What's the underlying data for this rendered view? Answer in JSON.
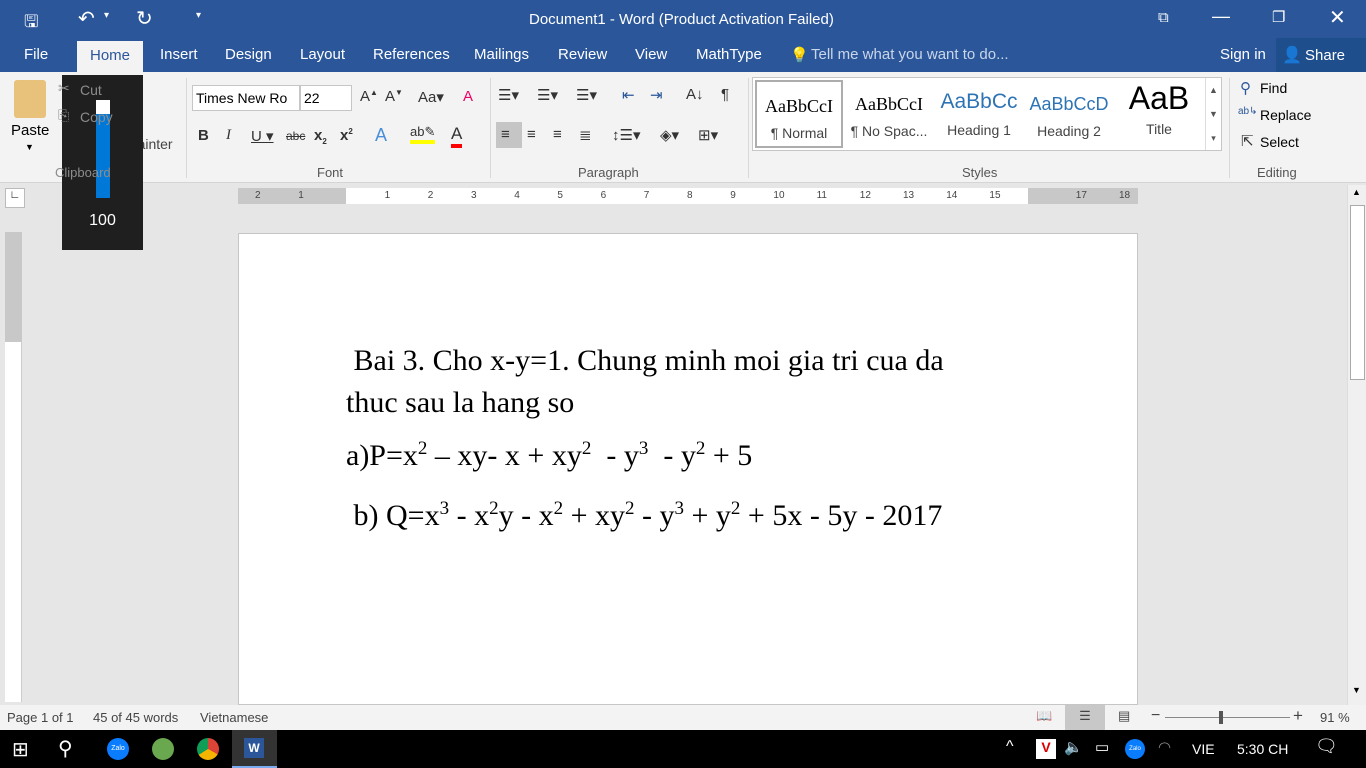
{
  "title": "Document1 - Word (Product Activation Failed)",
  "qat": {
    "save": "save-icon",
    "undo": "undo-icon",
    "redo": "redo-icon"
  },
  "tabs": [
    "File",
    "Home",
    "Insert",
    "Design",
    "Layout",
    "References",
    "Mailings",
    "Review",
    "View",
    "MathType"
  ],
  "tell_me": "Tell me what you want to do...",
  "sign_in": "Sign in",
  "share": "Share",
  "clipboard": {
    "paste": "Paste",
    "cut": "Cut",
    "copy": "Copy",
    "format_painter": "Format Painter",
    "label": "Clipboard"
  },
  "font": {
    "name": "Times New Ro",
    "size": "22",
    "label": "Font"
  },
  "paragraph": {
    "label": "Paragraph"
  },
  "styles": {
    "label": "Styles",
    "items": [
      {
        "preview": "AaBbCcI",
        "name": "¶ Normal"
      },
      {
        "preview": "AaBbCcI",
        "name": "¶ No Spac..."
      },
      {
        "preview": "AaBbCc",
        "name": "Heading 1"
      },
      {
        "preview": "AaBbCcD",
        "name": "Heading 2"
      },
      {
        "preview": "AaB",
        "name": "Title"
      }
    ]
  },
  "editing": {
    "find": "Find",
    "replace": "Replace",
    "select": "Select",
    "label": "Editing"
  },
  "volume": {
    "level": 100,
    "label": "100"
  },
  "ruler": [
    "2",
    "1",
    "",
    "1",
    "2",
    "3",
    "4",
    "5",
    "6",
    "7",
    "8",
    "9",
    "10",
    "11",
    "12",
    "13",
    "14",
    "15",
    "",
    "17",
    "18"
  ],
  "document": {
    "line1": " Bai 3. Cho x-y=1. Chung minh moi gia tri cua da",
    "line2": "thuc sau la hang so"
  },
  "status": {
    "page": "Page 1 of 1",
    "words": "45 of 45 words",
    "language": "Vietnamese",
    "zoom": "91 %",
    "zoom_value": 91
  },
  "taskbar": {
    "lang": "VIE",
    "time": "5:30 CH"
  },
  "colors": {
    "accent": "#2b579a",
    "highlight": "#ffff00",
    "font_color": "#ff0000"
  }
}
